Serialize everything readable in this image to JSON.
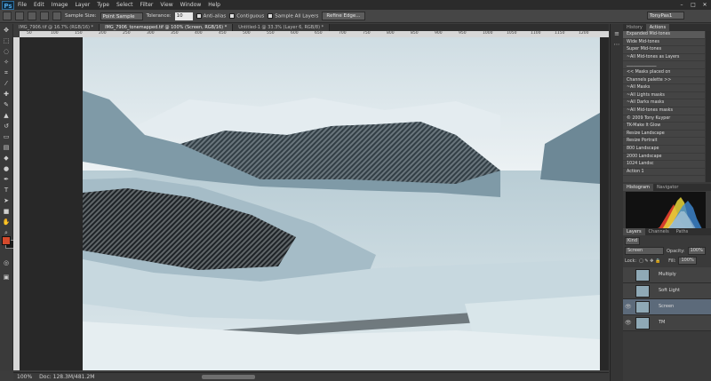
{
  "app": {
    "logo": "Ps"
  },
  "menu": [
    "File",
    "Edit",
    "Image",
    "Layer",
    "Type",
    "Select",
    "Filter",
    "View",
    "Window",
    "Help"
  ],
  "window_controls": [
    "–",
    "□",
    "✕"
  ],
  "options": {
    "sample_size_label": "Sample Size:",
    "sample_size_value": "Point Sample",
    "tolerance_label": "Tolerance:",
    "tolerance_value": "10",
    "anti_alias": "Anti-alias",
    "contiguous": "Contiguous",
    "sample_all_layers": "Sample All Layers",
    "refine_edge": "Refine Edge...",
    "workspace": "TonyPas1"
  },
  "doc_tabs": [
    {
      "label": "IMG_7906.tif @ 16.7% (RGB/16) *",
      "active": false
    },
    {
      "label": "IMG_7906_tonemapped.tif @ 100% (Screen, RGB/16) *",
      "active": true
    },
    {
      "label": "Untitled-1 @ 33.3% (Layer 6, RGB/8) *",
      "active": false
    }
  ],
  "ruler_top": [
    "50",
    "100",
    "150",
    "200",
    "250",
    "300",
    "350",
    "400",
    "450",
    "500",
    "550",
    "600",
    "650",
    "700",
    "750",
    "800",
    "850",
    "900",
    "950",
    "1000",
    "1050",
    "1100",
    "1150",
    "1200"
  ],
  "status": {
    "zoom": "100%",
    "doc": "Doc: 128.3M/481.2M"
  },
  "actions_panel": {
    "tabs": [
      {
        "label": "History",
        "active": false
      },
      {
        "label": "Actions",
        "active": true
      }
    ],
    "items": [
      {
        "label": "Expanded Mid-tones",
        "selected": true
      },
      {
        "label": "Wide Mid-tones",
        "selected": false
      },
      {
        "label": "Super Mid-tones",
        "selected": false
      },
      {
        "label": "~All Mid-tones as Layers",
        "selected": false
      },
      {
        "label": "______________",
        "selected": false
      },
      {
        "label": "<< Masks placed on",
        "selected": false
      },
      {
        "label": "Channels palette >>",
        "selected": false
      },
      {
        "label": "~All Masks",
        "selected": false
      },
      {
        "label": "~All Lights masks",
        "selected": false
      },
      {
        "label": "~All Darks masks",
        "selected": false
      },
      {
        "label": "~All Mid-tones masks",
        "selected": false
      },
      {
        "label": "© 2009 Tony Kuyper",
        "selected": false
      },
      {
        "label": "TK-Make It Glow",
        "selected": false
      },
      {
        "label": "Resize Landscape",
        "selected": false
      },
      {
        "label": "Resize Portrait",
        "selected": false
      },
      {
        "label": "800 Landscape",
        "selected": false
      },
      {
        "label": "2000 Landscape",
        "selected": false
      },
      {
        "label": "1024 Landsc",
        "selected": false
      },
      {
        "label": "Action 1",
        "selected": false
      }
    ]
  },
  "histogram_panel": {
    "tabs": [
      {
        "label": "Histogram",
        "active": true
      },
      {
        "label": "Navigator",
        "active": false
      }
    ]
  },
  "layers_panel": {
    "tabs": [
      {
        "label": "Layers",
        "active": true
      },
      {
        "label": "Channels",
        "active": false
      },
      {
        "label": "Paths",
        "active": false
      }
    ],
    "kind_label": "Kind",
    "blend_mode": "Screen",
    "opacity_label": "Opacity:",
    "opacity_value": "100%",
    "lock_label": "Lock:",
    "fill_label": "Fill:",
    "fill_value": "100%",
    "layers": [
      {
        "name": "Multiply",
        "selected": false,
        "visible": false
      },
      {
        "name": "Soft Light",
        "selected": false,
        "visible": false
      },
      {
        "name": "Screen",
        "selected": true,
        "visible": true
      },
      {
        "name": "TM",
        "selected": false,
        "visible": true
      }
    ]
  },
  "colors": {
    "foreground": "#d44a2c",
    "background": "#1a1a1a",
    "accent": "#5c6a7a"
  }
}
